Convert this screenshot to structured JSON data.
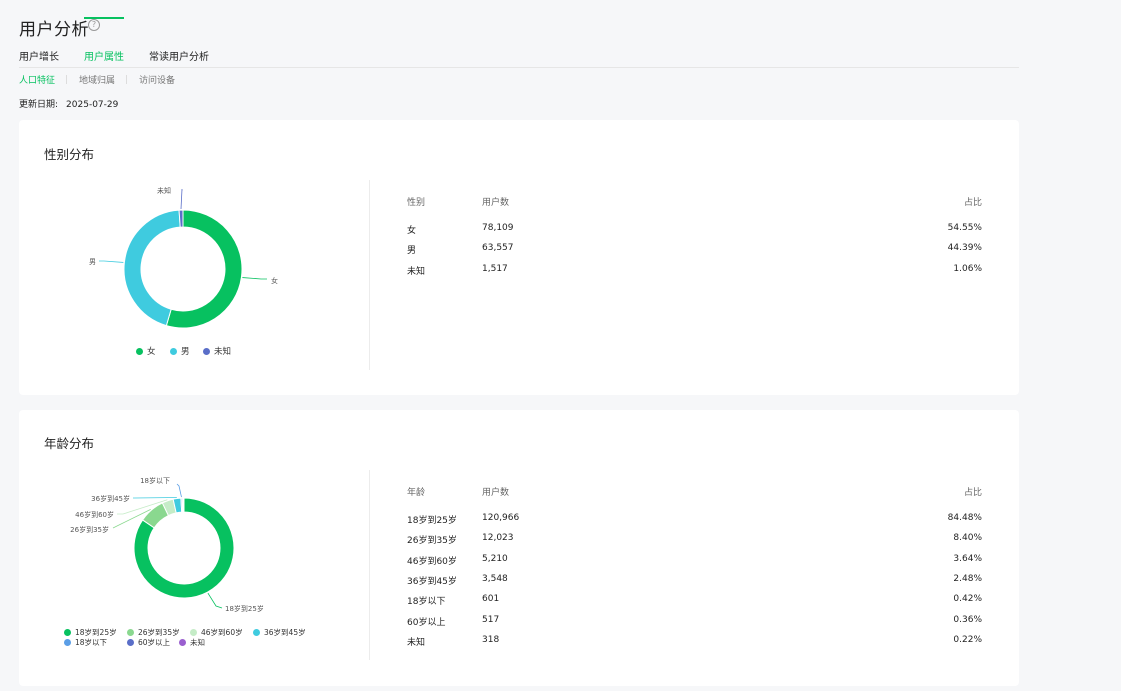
{
  "page": {
    "title": "用户分析",
    "help_icon": "?",
    "tabs": [
      {
        "label": "用户增长",
        "active": false
      },
      {
        "label": "用户属性",
        "active": true
      },
      {
        "label": "常读用户分析",
        "active": false
      }
    ],
    "subtabs": [
      {
        "label": "人口特征",
        "active": true
      },
      {
        "label": "地域归属",
        "active": false
      },
      {
        "label": "访问设备",
        "active": false
      }
    ],
    "update": {
      "label": "更新日期:",
      "value": "2025-07-29"
    }
  },
  "colors": {
    "accent": "#07c160",
    "female": "#07c160",
    "male": "#3fcbdf",
    "unknown": "#5a6ec8"
  },
  "gender": {
    "title": "性别分布",
    "headers": [
      "性别",
      "用户数",
      "占比"
    ],
    "rows": [
      {
        "name": "女",
        "count": "78,109",
        "pct": "54.55%"
      },
      {
        "name": "男",
        "count": "63,557",
        "pct": "44.39%"
      },
      {
        "name": "未知",
        "count": "1,517",
        "pct": "1.06%"
      }
    ],
    "legend": [
      "女",
      "男",
      "未知"
    ]
  },
  "age": {
    "title": "年龄分布",
    "headers": [
      "年龄",
      "用户数",
      "占比"
    ],
    "rows": [
      {
        "name": "18岁到25岁",
        "count": "120,966",
        "pct": "84.48%"
      },
      {
        "name": "26岁到35岁",
        "count": "12,023",
        "pct": "8.40%"
      },
      {
        "name": "46岁到60岁",
        "count": "5,210",
        "pct": "3.64%"
      },
      {
        "name": "36岁到45岁",
        "count": "3,548",
        "pct": "2.48%"
      },
      {
        "name": "18岁以下",
        "count": "601",
        "pct": "0.42%"
      },
      {
        "name": "60岁以上",
        "count": "517",
        "pct": "0.36%"
      },
      {
        "name": "未知",
        "count": "318",
        "pct": "0.22%"
      }
    ],
    "legend": [
      "18岁到25岁",
      "26岁到35岁",
      "46岁到60岁",
      "36岁到45岁",
      "18岁以下",
      "60岁以上",
      "未知"
    ]
  },
  "chart_data": [
    {
      "type": "pie",
      "title": "性别分布",
      "categories": [
        "女",
        "男",
        "未知"
      ],
      "values": [
        54.55,
        44.39,
        1.06
      ],
      "colors": [
        "#07c160",
        "#3fcbdf",
        "#5a6ec8"
      ],
      "legend": "bottom-center"
    },
    {
      "type": "pie",
      "title": "年龄分布",
      "categories": [
        "18岁到25岁",
        "26岁到35岁",
        "46岁到60岁",
        "36岁到45岁",
        "18岁以下",
        "60岁以上",
        "未知"
      ],
      "values": [
        84.48,
        8.4,
        3.64,
        2.48,
        0.42,
        0.36,
        0.22
      ],
      "colors": [
        "#07c160",
        "#8ad88f",
        "#c5ecc7",
        "#3fcbdf",
        "#5b9ee6",
        "#5a6ec8",
        "#9a5fcf"
      ],
      "legend": "bottom-center"
    }
  ]
}
